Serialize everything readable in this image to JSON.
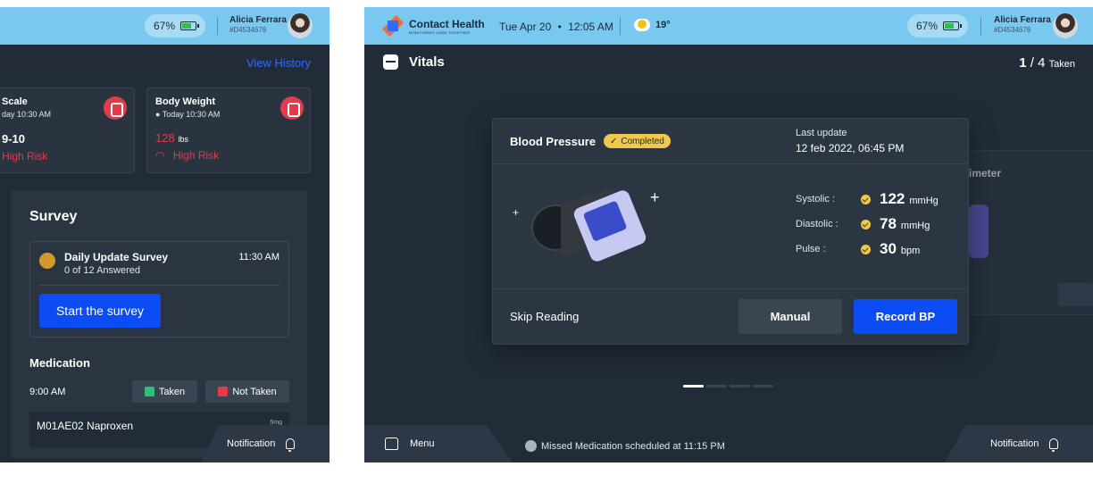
{
  "left_screen": {
    "battery": "67%",
    "user": {
      "name": "Alicia Ferrara",
      "id": "#D4534676"
    },
    "view_history": "View History",
    "scale_card": {
      "title": "Scale",
      "time": "day 10:30 AM",
      "value": "9-10",
      "risk": "High Risk"
    },
    "weight_card": {
      "title": "Body Weight",
      "time": "Today 10:30 AM",
      "value": "128",
      "unit": "lbs",
      "risk": "High Risk"
    },
    "survey": {
      "heading": "Survey",
      "item_title": "Daily Update Survey",
      "item_sub": "0 of 12 Answered",
      "item_time": "11:30 AM",
      "start_button": "Start the survey"
    },
    "medication": {
      "heading": "Medication",
      "time": "9:00 AM",
      "taken_button": "Taken",
      "not_taken_button": "Not Taken",
      "drug_name": "M01AE02 Naproxen",
      "drug_dose": "5mg"
    },
    "notification": "Notification"
  },
  "right_screen": {
    "brand": "Contact Health",
    "brand_tagline": "MONITORING CARE TOGETHER",
    "date": "Tue Apr 20",
    "time": "12:05 AM",
    "temperature": "19°",
    "battery": "67%",
    "user": {
      "name": "Alicia Ferrara",
      "id": "#D4534676"
    },
    "section_title": "Vitals",
    "progress_count": "1",
    "progress_total": "/ 4",
    "progress_label": "Taken",
    "bp_card": {
      "title": "Blood Pressure",
      "status_badge": "Completed",
      "last_update_label": "Last update",
      "last_update_value": "12 feb 2022, 06:45 PM",
      "readings": [
        {
          "label": "Systolic :",
          "value": "122",
          "unit": "mmHg"
        },
        {
          "label": "Diastolic :",
          "value": "78",
          "unit": "mmHg"
        },
        {
          "label": "Pulse :",
          "value": "30",
          "unit": "bpm"
        }
      ],
      "skip_button": "Skip Reading",
      "manual_button": "Manual",
      "record_button": "Record BP"
    },
    "next_card_title": "imeter",
    "menu_label": "Menu",
    "missed_alert": "Missed Medication scheduled at 11:15 PM",
    "notification": "Notification",
    "colors": {
      "topbar": "#79c8ef",
      "primary": "#0b4cf5",
      "risk": "#e23c4a",
      "completed": "#f0c94a"
    }
  }
}
